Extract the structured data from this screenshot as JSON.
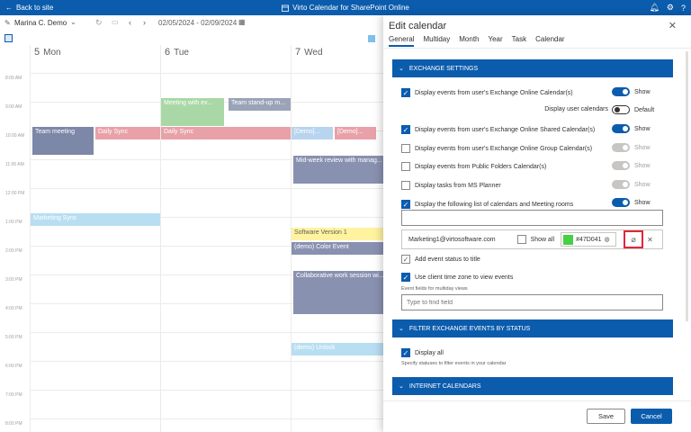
{
  "topbar": {
    "back_label": "Back to site",
    "app_title": "Virto Calendar for SharePoint Online",
    "icons": [
      "back-arrow-icon",
      "calendar-icon",
      "bell-icon",
      "gear-icon",
      "question-icon"
    ]
  },
  "toolbar": {
    "user": "Marina C. Demo",
    "date_range": "02/05/2024 - 02/09/2024"
  },
  "calendar": {
    "days": [
      {
        "num": "5",
        "name": "Mon"
      },
      {
        "num": "6",
        "name": "Tue"
      },
      {
        "num": "7",
        "name": "Wed"
      }
    ],
    "times": [
      "8:00 AM",
      "9:00 AM",
      "10:00 AM",
      "11:00 AM",
      "12:00 PM",
      "1:00 PM",
      "2:00 PM",
      "3:00 PM",
      "4:00 PM",
      "5:00 PM",
      "6:00 PM",
      "7:00 PM",
      "8:00 PM"
    ],
    "events": [
      {
        "label": "Meeting with ex...",
        "color": "#a9d8a6"
      },
      {
        "label": "Team stand-up m...",
        "color": "#9aa3b8"
      },
      {
        "label": "Team meeting",
        "color": "#7d87a8"
      },
      {
        "label": "Daily Sync",
        "color": "#e8a1a8"
      },
      {
        "label": "Daily Sync",
        "color": "#e8a1a8"
      },
      {
        "label": "[Demo]...",
        "color": "#b8d4ee"
      },
      {
        "label": "[Demo]...",
        "color": "#e8a1a8"
      },
      {
        "label": "Mid-week review with manag...",
        "color": "#8991b0"
      },
      {
        "label": "Marketing Sync",
        "color": "#b8def2"
      },
      {
        "label": "Software Version 1",
        "color": "#fff3a0"
      },
      {
        "label": "(demo) Color Event",
        "color": "#8991b0"
      },
      {
        "label": "Collaborative work session wi...",
        "color": "#8991b0"
      },
      {
        "label": "(demo) Unlock",
        "color": "#b8def2"
      }
    ]
  },
  "panel": {
    "title": "Edit calendar",
    "tabs": [
      "General",
      "Multiday",
      "Month",
      "Year",
      "Task",
      "Calendar"
    ],
    "active_tab": "General",
    "exchange": {
      "header": "EXCHANGE SETTINGS",
      "rows": [
        {
          "label": "Display events from user's Exchange Online Calendar(s)",
          "checked": true,
          "toggle_on": true,
          "toggle_label": "Show"
        },
        {
          "label": "Display user calendars",
          "toggle_on": false,
          "toggle_label": "Default"
        },
        {
          "label": "Display events from user's Exchange Online Shared Calendar(s)",
          "checked": true,
          "toggle_on": true,
          "toggle_label": "Show"
        },
        {
          "label": "Display events from user's Exchange Online Group Calendar(s)",
          "checked": false,
          "toggle_on": false,
          "toggle_label": "Show"
        },
        {
          "label": "Display events from Public Folders Calendar(s)",
          "checked": false,
          "toggle_on": false,
          "toggle_label": "Show"
        },
        {
          "label": "Display tasks from MS Planner",
          "checked": false,
          "toggle_on": false,
          "toggle_label": "Show"
        },
        {
          "label": "Display the following list of calendars and Meeting rooms",
          "checked": true,
          "toggle_on": true,
          "toggle_label": "Show"
        }
      ],
      "mailbox": {
        "email": "Marketing1@virtosoftware.com",
        "show_all_label": "Show all",
        "color_value": "#47D041",
        "color_swatch": "#47D041"
      },
      "add_status_label": "Add event status to title",
      "client_tz_label": "Use client time zone to view events",
      "event_fields_hint": "Event fields for multiday views",
      "find_field_placeholder": "Type to find field"
    },
    "filter": {
      "header": "FILTER EXCHANGE EVENTS BY STATUS",
      "display_all_label": "Display all",
      "hint": "Specify statuses to filter events in your calendar"
    },
    "internet": {
      "header": "INTERNET CALENDARS"
    },
    "save_label": "Save",
    "cancel_label": "Cancel"
  },
  "colors": {
    "brand": "#0b5cad",
    "highlight": "#e3263a"
  }
}
